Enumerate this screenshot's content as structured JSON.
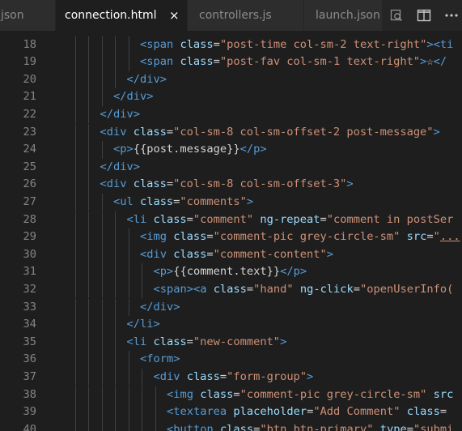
{
  "tabs": [
    {
      "label": "json",
      "active": false
    },
    {
      "label": "connection.html",
      "active": true,
      "close_glyph": "×"
    },
    {
      "label": "controllers.js",
      "active": false
    },
    {
      "label": "launch.json",
      "active": false
    }
  ],
  "actions": [
    {
      "icon": "open-preview-icon"
    },
    {
      "icon": "split-editor-icon"
    },
    {
      "icon": "more-actions-icon"
    }
  ],
  "editor": {
    "lines": [
      {
        "num": "18",
        "indent": 6,
        "tokens": [
          [
            "tag",
            "<span "
          ],
          [
            "attr",
            "class"
          ],
          [
            "txt",
            "="
          ],
          [
            "str",
            "\"post-time col-sm-2 text-right\""
          ],
          [
            "tag",
            ">"
          ],
          [
            "tag",
            "<ti"
          ]
        ]
      },
      {
        "num": "19",
        "indent": 6,
        "tokens": [
          [
            "tag",
            "<span "
          ],
          [
            "attr",
            "class"
          ],
          [
            "txt",
            "="
          ],
          [
            "str",
            "\"post-fav col-sm-1 text-right\""
          ],
          [
            "tag",
            ">"
          ],
          [
            "txt",
            "☆"
          ],
          [
            "tag",
            "</"
          ]
        ]
      },
      {
        "num": "20",
        "indent": 5,
        "tokens": [
          [
            "tag",
            "</div>"
          ]
        ]
      },
      {
        "num": "21",
        "indent": 4,
        "tokens": [
          [
            "tag",
            "</div>"
          ]
        ]
      },
      {
        "num": "22",
        "indent": 3,
        "tokens": [
          [
            "tag",
            "</div>"
          ]
        ]
      },
      {
        "num": "23",
        "indent": 3,
        "tokens": [
          [
            "tag",
            "<div "
          ],
          [
            "attr",
            "class"
          ],
          [
            "txt",
            "="
          ],
          [
            "str",
            "\"col-sm-8 col-sm-offset-2 post-message\""
          ],
          [
            "tag",
            ">"
          ]
        ]
      },
      {
        "num": "24",
        "indent": 4,
        "tokens": [
          [
            "tag",
            "<p>"
          ],
          [
            "txt",
            "{{post.message}}"
          ],
          [
            "tag",
            "</p>"
          ]
        ]
      },
      {
        "num": "25",
        "indent": 3,
        "tokens": [
          [
            "tag",
            "</div>"
          ]
        ]
      },
      {
        "num": "26",
        "indent": 3,
        "tokens": [
          [
            "tag",
            "<div "
          ],
          [
            "attr",
            "class"
          ],
          [
            "txt",
            "="
          ],
          [
            "str",
            "\"col-sm-8 col-sm-offset-3\""
          ],
          [
            "tag",
            ">"
          ]
        ]
      },
      {
        "num": "27",
        "indent": 4,
        "tokens": [
          [
            "tag",
            "<ul "
          ],
          [
            "attr",
            "class"
          ],
          [
            "txt",
            "="
          ],
          [
            "str",
            "\"comments\""
          ],
          [
            "tag",
            ">"
          ]
        ]
      },
      {
        "num": "28",
        "indent": 5,
        "tokens": [
          [
            "tag",
            "<li "
          ],
          [
            "attr",
            "class"
          ],
          [
            "txt",
            "="
          ],
          [
            "str",
            "\"comment\""
          ],
          [
            "txt",
            " "
          ],
          [
            "attr",
            "ng-repeat"
          ],
          [
            "txt",
            "="
          ],
          [
            "str",
            "\"comment in postSer"
          ]
        ]
      },
      {
        "num": "29",
        "indent": 6,
        "tokens": [
          [
            "tag",
            "<img "
          ],
          [
            "attr",
            "class"
          ],
          [
            "txt",
            "="
          ],
          [
            "str",
            "\"comment-pic grey-circle-sm\""
          ],
          [
            "txt",
            " "
          ],
          [
            "attr",
            "src"
          ],
          [
            "txt",
            "="
          ],
          [
            "str",
            "\""
          ],
          [
            "link",
            "..."
          ]
        ]
      },
      {
        "num": "30",
        "indent": 6,
        "tokens": [
          [
            "tag",
            "<div "
          ],
          [
            "attr",
            "class"
          ],
          [
            "txt",
            "="
          ],
          [
            "str",
            "\"comment-content\""
          ],
          [
            "tag",
            ">"
          ]
        ]
      },
      {
        "num": "31",
        "indent": 7,
        "tokens": [
          [
            "tag",
            "<p>"
          ],
          [
            "txt",
            "{{comment.text}}"
          ],
          [
            "tag",
            "</p>"
          ]
        ]
      },
      {
        "num": "32",
        "indent": 7,
        "tokens": [
          [
            "tag",
            "<span>"
          ],
          [
            "tag",
            "<a "
          ],
          [
            "attr",
            "class"
          ],
          [
            "txt",
            "="
          ],
          [
            "str",
            "\"hand\""
          ],
          [
            "txt",
            " "
          ],
          [
            "attr",
            "ng-click"
          ],
          [
            "txt",
            "="
          ],
          [
            "str",
            "\"openUserInfo("
          ]
        ]
      },
      {
        "num": "33",
        "indent": 6,
        "tokens": [
          [
            "tag",
            "</div>"
          ]
        ]
      },
      {
        "num": "34",
        "indent": 5,
        "tokens": [
          [
            "tag",
            "</li>"
          ]
        ]
      },
      {
        "num": "35",
        "indent": 5,
        "tokens": [
          [
            "tag",
            "<li "
          ],
          [
            "attr",
            "class"
          ],
          [
            "txt",
            "="
          ],
          [
            "str",
            "\"new-comment\""
          ],
          [
            "tag",
            ">"
          ]
        ]
      },
      {
        "num": "36",
        "indent": 6,
        "tokens": [
          [
            "tag",
            "<form>"
          ]
        ]
      },
      {
        "num": "37",
        "indent": 7,
        "tokens": [
          [
            "tag",
            "<div "
          ],
          [
            "attr",
            "class"
          ],
          [
            "txt",
            "="
          ],
          [
            "str",
            "\"form-group\""
          ],
          [
            "tag",
            ">"
          ]
        ]
      },
      {
        "num": "38",
        "indent": 8,
        "tokens": [
          [
            "tag",
            "<img "
          ],
          [
            "attr",
            "class"
          ],
          [
            "txt",
            "="
          ],
          [
            "str",
            "\"comment-pic grey-circle-sm\""
          ],
          [
            "txt",
            " "
          ],
          [
            "attr",
            "src"
          ]
        ]
      },
      {
        "num": "39",
        "indent": 8,
        "tokens": [
          [
            "tag",
            "<textarea "
          ],
          [
            "attr",
            "placeholder"
          ],
          [
            "txt",
            "="
          ],
          [
            "str",
            "\"Add Comment\""
          ],
          [
            "txt",
            " "
          ],
          [
            "attr",
            "class"
          ],
          [
            "txt",
            "="
          ]
        ]
      },
      {
        "num": "40",
        "indent": 8,
        "tokens": [
          [
            "tag",
            "<button "
          ],
          [
            "attr",
            "class"
          ],
          [
            "txt",
            "="
          ],
          [
            "str",
            "\"btn btn-primary\""
          ],
          [
            "txt",
            " "
          ],
          [
            "attr",
            "type"
          ],
          [
            "txt",
            "="
          ],
          [
            "str",
            "\"submi"
          ]
        ]
      }
    ]
  },
  "colors": {
    "background": "#1e1e1e",
    "tag": "#569cd6",
    "attribute": "#9cdcfe",
    "string": "#ce9178",
    "text": "#d4d4d4",
    "line_number": "#858585"
  }
}
